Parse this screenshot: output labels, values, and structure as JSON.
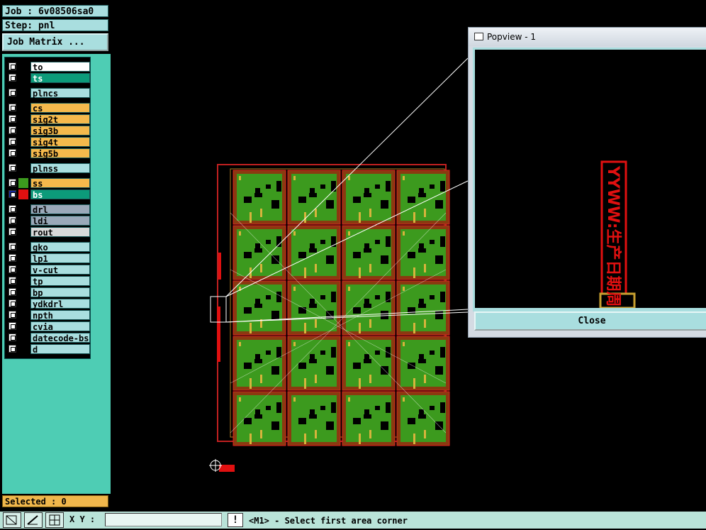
{
  "job": {
    "label": "Job : 6v08506sa0"
  },
  "step": {
    "label": "Step: pnl"
  },
  "job_matrix_button": "Job Matrix ...",
  "layers": [
    {
      "name": "to",
      "color": "#ffffff"
    },
    {
      "name": "ts",
      "color": "#0c9b7a",
      "text_color": "#ffffff"
    },
    {
      "name": "plncs",
      "color": "#a9dedf"
    },
    {
      "name": "cs",
      "color": "#f5b94c"
    },
    {
      "name": "sig2t",
      "color": "#f5b94c"
    },
    {
      "name": "sig3b",
      "color": "#f5b94c"
    },
    {
      "name": "sig4t",
      "color": "#f5b94c"
    },
    {
      "name": "sig5b",
      "color": "#f5b94c"
    },
    {
      "name": "plnss",
      "color": "#a9dedf"
    },
    {
      "name": "ss",
      "color": "#f5b94c",
      "swatch": "#3c9a1e"
    },
    {
      "name": "bs",
      "color": "#0c9b7a",
      "swatch": "#e01010",
      "text_color": "#ffffff",
      "active": true
    },
    {
      "name": "drl",
      "color": "#9aa9b9"
    },
    {
      "name": "ldi",
      "color": "#9aa9b9"
    },
    {
      "name": "rout",
      "color": "#d8d8d8"
    },
    {
      "name": "gko",
      "color": "#a9dedf"
    },
    {
      "name": "lp1",
      "color": "#a9dedf"
    },
    {
      "name": "v-cut",
      "color": "#a9dedf"
    },
    {
      "name": "tp",
      "color": "#a9dedf"
    },
    {
      "name": "bp",
      "color": "#a9dedf"
    },
    {
      "name": "ydkdrl",
      "color": "#a9dedf"
    },
    {
      "name": "npth",
      "color": "#a9dedf"
    },
    {
      "name": "cvia",
      "color": "#a9dedf"
    },
    {
      "name": "datecode-bs",
      "color": "#a9dedf"
    },
    {
      "name": "d",
      "color": "#a9dedf"
    }
  ],
  "selected": {
    "label": "Selected : 0"
  },
  "coordinates": {
    "label": "X Y :",
    "value": ""
  },
  "status": {
    "message": "<M1> - Select first area corner"
  },
  "popview": {
    "title": "Popview - 1",
    "close_label": "Close",
    "datecode_text": "YYWW:生产日期周"
  },
  "colors": {
    "panel_teal": "#4ecdb4",
    "header_blue": "#a9dedf",
    "board_green": "#3c9a1e",
    "copper_red": "#e01010",
    "pad_yellow": "#d6b43c"
  }
}
